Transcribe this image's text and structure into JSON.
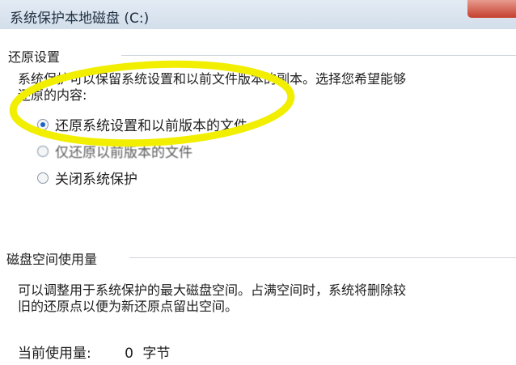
{
  "window": {
    "title": "系统保护本地磁盘 (C:)"
  },
  "restore_settings": {
    "heading": "还原设置",
    "description_line1": "系统保护可以保留系统设置和以前文件版本的副本。选择您希望能够",
    "description_line2": "还原的内容:",
    "options": [
      {
        "label": "还原系统设置和以前版本的文件",
        "selected": true
      },
      {
        "label": "仅还原以前版本的文件",
        "selected": false
      },
      {
        "label": "关闭系统保护",
        "selected": false
      }
    ]
  },
  "disk_space": {
    "heading": "磁盘空间使用量",
    "description_line1": "可以调整用于系统保护的最大磁盘空间。占满空间时，系统将删除较",
    "description_line2": "旧的还原点以便为新还原点留出空间。",
    "current_usage_label": "当前使用量:",
    "current_usage_value": "0",
    "current_usage_unit": "字节"
  },
  "annotation": {
    "color": "#f2ee00",
    "shape": "ellipse-highlight"
  },
  "colors": {
    "radio_selected": "#1c64c8",
    "close_button": "#c5402f"
  }
}
